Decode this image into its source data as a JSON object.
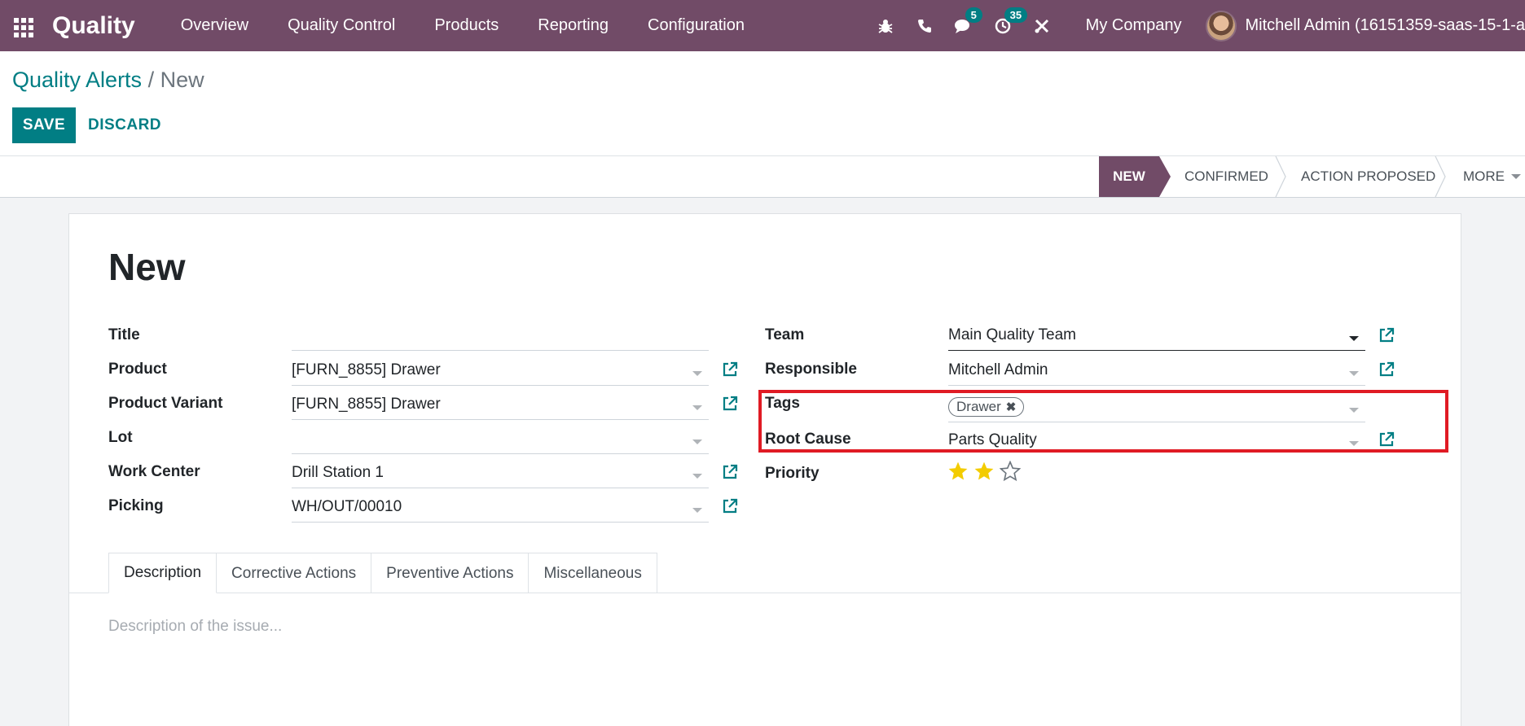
{
  "navbar": {
    "brand": "Quality",
    "menu": [
      "Overview",
      "Quality Control",
      "Products",
      "Reporting",
      "Configuration"
    ],
    "messages_count": "5",
    "activities_count": "35",
    "company": "My Company",
    "user": "Mitchell Admin (16151359-saas-15-1-a"
  },
  "breadcrumb": {
    "parent": "Quality Alerts",
    "separator": "/",
    "current": "New"
  },
  "actions": {
    "save": "SAVE",
    "discard": "DISCARD"
  },
  "statusbar": {
    "stages": [
      "NEW",
      "CONFIRMED",
      "ACTION PROPOSED"
    ],
    "active": "NEW",
    "more": "MORE"
  },
  "form": {
    "title": "New",
    "left": {
      "title_label": "Title",
      "title_value": "",
      "product_label": "Product",
      "product_value": "[FURN_8855] Drawer",
      "variant_label": "Product Variant",
      "variant_value": "[FURN_8855] Drawer",
      "lot_label": "Lot",
      "lot_value": "",
      "workcenter_label": "Work Center",
      "workcenter_value": "Drill Station 1",
      "picking_label": "Picking",
      "picking_value": "WH/OUT/00010"
    },
    "right": {
      "team_label": "Team",
      "team_value": "Main Quality Team",
      "responsible_label": "Responsible",
      "responsible_value": "Mitchell Admin",
      "tags_label": "Tags",
      "tags": [
        "Drawer"
      ],
      "root_cause_label": "Root Cause",
      "root_cause_value": "Parts Quality",
      "priority_label": "Priority",
      "priority_stars_filled": 2,
      "priority_stars_total": 3
    }
  },
  "tabs": [
    "Description",
    "Corrective Actions",
    "Preventive Actions",
    "Miscellaneous"
  ],
  "active_tab": "Description",
  "description_placeholder": "Description of the issue...",
  "colors": {
    "brand": "#714b67",
    "accent": "#017e84",
    "highlight": "#e01b24",
    "star": "#f3cc00"
  }
}
